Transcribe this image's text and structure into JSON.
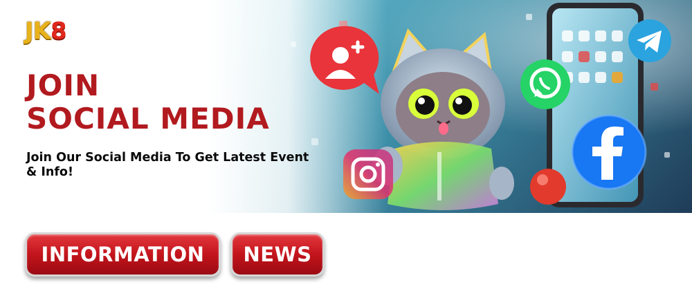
{
  "banner": {
    "logo_prefix": "JK",
    "logo_suffix": "8",
    "title_line1": "JOIN",
    "title_line2": "SOCIAL MEDIA",
    "subtitle": "Join Our Social Media To Get Latest Event & Info!"
  },
  "buttons": {
    "information_label": "INFORMATION",
    "news_label": "NEWS"
  },
  "icons": [
    "add-user-icon",
    "whatsapp-icon",
    "telegram-icon",
    "facebook-icon",
    "instagram-icon",
    "smartphone-icon",
    "cat-mascot-illustration"
  ],
  "colors": {
    "title_red": "#b11a1f",
    "button_red": "#c3141c",
    "logo_gold": "#e8b21a",
    "facebook_blue": "#1877f2",
    "whatsapp_green": "#25d366",
    "telegram_blue": "#2aa3df"
  }
}
